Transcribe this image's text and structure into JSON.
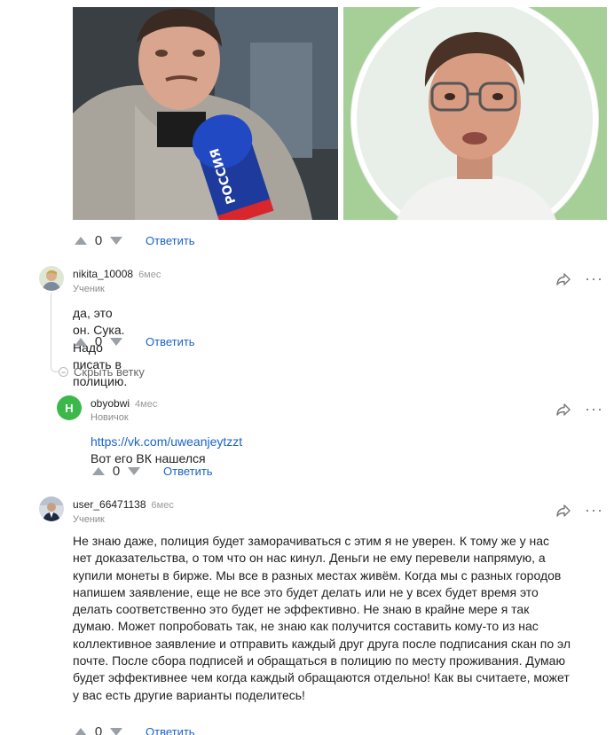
{
  "post_images": [
    {
      "description_name": "photo-left"
    },
    {
      "description_name": "photo-right"
    }
  ],
  "microphone_label": "РОССИЯ",
  "top_votes": {
    "count": "0",
    "reply": "Ответить"
  },
  "comments": [
    {
      "username": "nikita_10008",
      "time": "6мес",
      "rank": "Ученик",
      "text": "да, это он. Сука. Надо писать в полицию.",
      "votes": "0",
      "reply": "Ответить"
    },
    {
      "username": "obyobwi",
      "time": "4мес",
      "rank": "Новичок",
      "avatar_letter": "Н",
      "link": "https://vk.com/uweanjeytzzt",
      "text": " Вот его ВК нашелся",
      "votes": "0",
      "reply": "Ответить"
    },
    {
      "username": "user_66471138",
      "time": "6мес",
      "rank": "Ученик",
      "text_lines": [
        "Не знаю даже, полиция будет заморачиваться с этим я не уверен. К тому же у нас",
        "нет доказательства, о том что он нас кинул. Деньги не ему перевели напрямую, а",
        "купили монеты в бирже. Мы все в разных местах живём.  Когда мы с разных городов",
        "напишем заявление, еще не все это будет делать или не у всех будет время это",
        "делать соответственно это будет не эффективно. Не знаю в крайне мере я так",
        "думаю. Может попробовать так, не знаю как получится составить кому-то из нас",
        "коллективное заявление и отправить каждый друг друга после подписания скан по эл",
        "почте. После сбора подписей и обращаться в полицию по месту проживания. Думаю",
        "будет эффективнее чем когда каждый обращаются отдельно! Как вы считаете, может",
        "у вас есть другие варианты поделитесь!"
      ],
      "votes": "0",
      "reply": "Ответить"
    }
  ],
  "collapse_label": "Скрыть ветку",
  "colors": {
    "link": "#1a62c9",
    "avatar_green": "#3cb84a",
    "vote_arrow": "#9aa0a6"
  }
}
